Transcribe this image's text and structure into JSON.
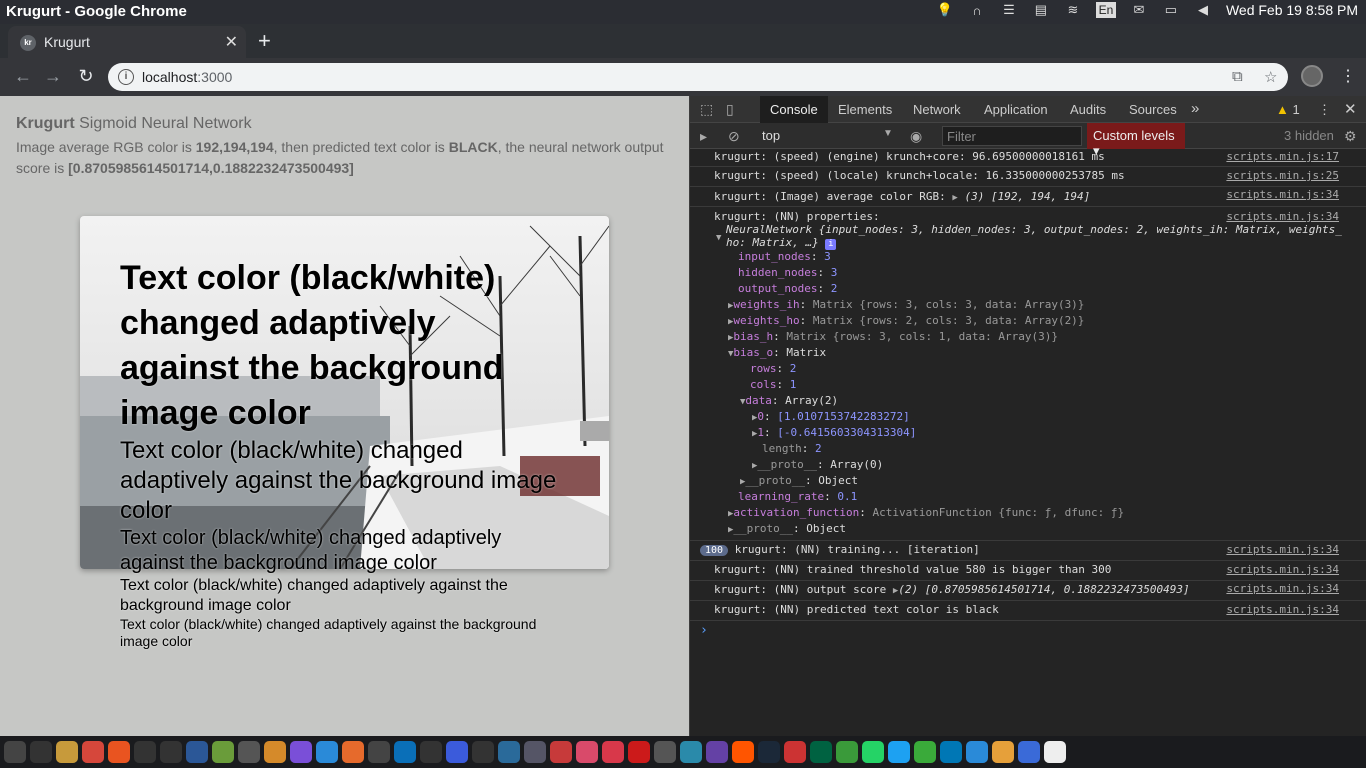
{
  "window_title": "Krugurt - Google Chrome",
  "system": {
    "input_lang": "En",
    "datetime": "Wed Feb 19  8:58 PM"
  },
  "tab": {
    "favicon": "kr",
    "title": "Krugurt"
  },
  "address": {
    "host": "localhost",
    "port": ":3000"
  },
  "page": {
    "brand": "Krugurt",
    "subtitle": " Sigmoid Neural Network",
    "p1": "Image average RGB color is ",
    "rgb": "192,194,194",
    "p2": ", then predicted text color is ",
    "color": "BLACK",
    "p3": ", the neural network output score is ",
    "score": "[0.8705985614501714,0.1882232473500493]",
    "samples": [
      "Text color (black/white) changed adaptively against the background image color",
      "Text color (black/white) changed adaptively against the background image color",
      "Text color (black/white) changed adaptively against the background image color",
      "Text color (black/white) changed adaptively against the background image color",
      "Text color (black/white) changed adaptively against the background image color"
    ]
  },
  "devtools": {
    "tabs": [
      "Console",
      "Elements",
      "Network",
      "Application",
      "Audits",
      "Sources"
    ],
    "more": "»",
    "warnings": "1",
    "context": "top",
    "filter_placeholder": "Filter",
    "levels": "Custom levels",
    "hidden": "3 hidden",
    "console": {
      "l1": "krugurt: (speed) (engine) krunch+core: 96.69500000018161 ms",
      "l1_src": "scripts.min.js:17",
      "l2": "krugurt: (speed) (locale) krunch+locale: 16.335000000253785 ms",
      "l2_src": "scripts.min.js:25",
      "l3a": "krugurt: (Image) average color RGB: ",
      "l3b": "(3) [192, 194, 194]",
      "l3_src": "scripts.min.js:34",
      "l4": "krugurt: (NN) properties:",
      "l4_src": "scripts.min.js:34",
      "nn_head1": "NeuralNetwork {input_nodes: 3, hidden_nodes: 3, output_nodes: 2, weights_ih: Matrix, weights_",
      "nn_head2": "ho: Matrix, …}",
      "input_nodes_k": "input_nodes",
      "input_nodes_v": "3",
      "hidden_nodes_k": "hidden_nodes",
      "hidden_nodes_v": "3",
      "output_nodes_k": "output_nodes",
      "output_nodes_v": "2",
      "weights_ih_k": "weights_ih",
      "weights_ih_v": "Matrix {rows: 3, cols: 3, data: Array(3)}",
      "weights_ho_k": "weights_ho",
      "weights_ho_v": "Matrix {rows: 2, cols: 3, data: Array(2)}",
      "bias_h_k": "bias_h",
      "bias_h_v": "Matrix {rows: 3, cols: 1, data: Array(3)}",
      "bias_o_k": "bias_o",
      "bias_o_v": "Matrix",
      "rows_k": "rows",
      "rows_v": "2",
      "cols_k": "cols",
      "cols_v": "1",
      "data_k": "data",
      "data_v": "Array(2)",
      "d0_k": "0",
      "d0_v": "[1.0107153742283272]",
      "d1_k": "1",
      "d1_v": "[-0.6415603304313304]",
      "length_k": "length",
      "length_v": "2",
      "proto1_k": "__proto__",
      "proto1_v": "Array(0)",
      "proto2_k": "__proto__",
      "proto2_v": "Object",
      "lr_k": "learning_rate",
      "lr_v": "0.1",
      "af_k": "activation_function",
      "af_v": "ActivationFunction {func: ƒ, dfunc: ƒ}",
      "proto3_k": "__proto__",
      "proto3_v": "Object",
      "badge": "100",
      "l5": "krugurt: (NN) training... [iteration]",
      "l5_src": "scripts.min.js:34",
      "l6": "krugurt: (NN) trained threshold value 580 is bigger than 300",
      "l6_src": "scripts.min.js:34",
      "l7a": "krugurt: (NN) output score ",
      "l7b": "(2) [0.8705985614501714, 0.1882232473500493]",
      "l7_src": "scripts.min.js:34",
      "l8": "krugurt: (NN) predicted text color is black",
      "l8_src": "scripts.min.js:34",
      "prompt": "›"
    }
  },
  "colors": {
    "page_bg": "#c6c7c5",
    "devtools_bg": "#242424",
    "levels_bg": "#7a1a1a",
    "prop": "#c67edc",
    "number": "#8d95ff"
  },
  "dock": [
    {
      "name": "settings",
      "c": "#444"
    },
    {
      "name": "terminal",
      "c": "#333"
    },
    {
      "name": "files",
      "c": "#c79a3b"
    },
    {
      "name": "chrome",
      "c": "#d6473b"
    },
    {
      "name": "ubuntu-software",
      "c": "#e95420"
    },
    {
      "name": "app-n1",
      "c": "#333"
    },
    {
      "name": "app-n2",
      "c": "#333"
    },
    {
      "name": "ws",
      "c": "#2b5797"
    },
    {
      "name": "android",
      "c": "#6a9c3a"
    },
    {
      "name": "text-editor",
      "c": "#555"
    },
    {
      "name": "sublime",
      "c": "#d58a2a"
    },
    {
      "name": "app-purple",
      "c": "#7a4fd8"
    },
    {
      "name": "app-blue",
      "c": "#2a8ad8"
    },
    {
      "name": "app-orange",
      "c": "#e66a2c"
    },
    {
      "name": "app-dark",
      "c": "#444"
    },
    {
      "name": "trello",
      "c": "#0a6fb8"
    },
    {
      "name": "github",
      "c": "#333"
    },
    {
      "name": "pocket-blue",
      "c": "#3b5bdb"
    },
    {
      "name": "app-home",
      "c": "#333"
    },
    {
      "name": "app-bird",
      "c": "#2a6a9a"
    },
    {
      "name": "app-gray",
      "c": "#556"
    },
    {
      "name": "app-red",
      "c": "#c73a3a"
    },
    {
      "name": "app-pink",
      "c": "#d94a6a"
    },
    {
      "name": "pocket",
      "c": "#d8384a"
    },
    {
      "name": "youtube",
      "c": "#cc1a1a"
    },
    {
      "name": "app-circle",
      "c": "#555"
    },
    {
      "name": "app-play",
      "c": "#2a8aaa"
    },
    {
      "name": "twitch",
      "c": "#6441a5"
    },
    {
      "name": "soundcloud",
      "c": "#ff5500"
    },
    {
      "name": "steam",
      "c": "#1b2838"
    },
    {
      "name": "app-car",
      "c": "#c33"
    },
    {
      "name": "starbucks",
      "c": "#006241"
    },
    {
      "name": "app-green",
      "c": "#3a9a3a"
    },
    {
      "name": "whatsapp",
      "c": "#25d366"
    },
    {
      "name": "twitter",
      "c": "#1da1f2"
    },
    {
      "name": "app-chat",
      "c": "#3aaa3a"
    },
    {
      "name": "linkedin",
      "c": "#0077b5"
    },
    {
      "name": "app-h",
      "c": "#2a8ad8"
    },
    {
      "name": "app-maps",
      "c": "#e6a03a"
    },
    {
      "name": "app-blue2",
      "c": "#3a6ad8"
    },
    {
      "name": "google",
      "c": "#eee"
    }
  ]
}
